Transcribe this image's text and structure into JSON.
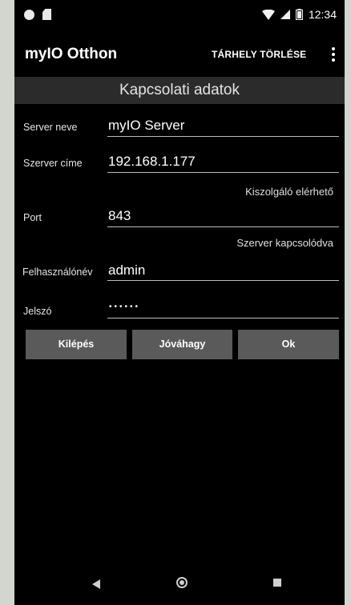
{
  "status_bar": {
    "time": "12:34",
    "icons": [
      "notification-dot-icon",
      "sd-card-icon",
      "wifi-icon",
      "signal-icon",
      "battery-icon"
    ]
  },
  "app_bar": {
    "title": "myIO Otthon",
    "clear_storage_label": "TÁRHELY TÖRLÉSE",
    "menu_icon": "more-vert-icon"
  },
  "section_title": "Kapcsolati adatok",
  "form": {
    "server_name": {
      "label": "Server neve",
      "value": "myIO Server"
    },
    "server_address": {
      "label": "Szerver címe",
      "value": "192.168.1.177"
    },
    "server_status": "Kiszolgáló elérhető",
    "port": {
      "label": "Port",
      "value": "843"
    },
    "port_status": "Szerver kapcsolódva",
    "username": {
      "label": "Felhasználónév",
      "value": "admin"
    },
    "password": {
      "label": "Jelszó",
      "value": "••••••"
    }
  },
  "buttons": {
    "exit": "Kilépés",
    "approve": "Jóváhagy",
    "ok": "Ok"
  },
  "colors": {
    "background": "#000000",
    "section_header": "#2b2b2b",
    "button": "#5a5a5a",
    "frame": "#d3d6cf"
  }
}
